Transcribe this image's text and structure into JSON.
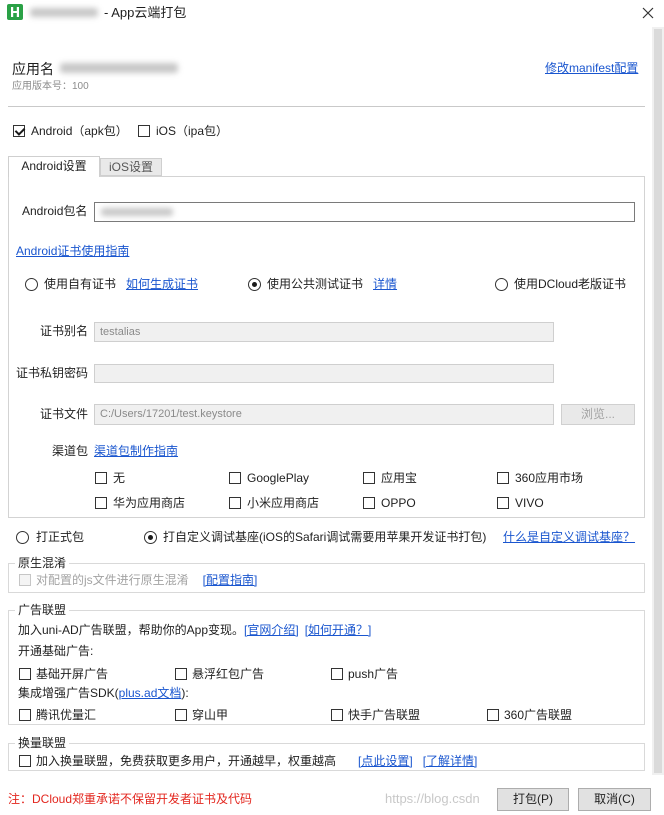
{
  "window": {
    "title": "- App云端打包",
    "logo_letter": "H"
  },
  "icons": {
    "logo": "hbuilder-logo-icon",
    "close": "close-icon"
  },
  "header": {
    "app_name_label": "应用名",
    "version_text": "应用版本号：100",
    "edit_manifest_link": "修改manifest配置"
  },
  "platforms": [
    {
      "label": "Android（apk包）",
      "checked": true
    },
    {
      "label": "iOS（ipa包）",
      "checked": false
    }
  ],
  "tabs": [
    {
      "label": "Android设置",
      "active": true
    },
    {
      "label": "iOS设置",
      "active": false
    }
  ],
  "android": {
    "package_label": "Android包名",
    "cert_guide_link": "Android证书使用指南",
    "cert_options": [
      {
        "label": "使用自有证书",
        "checked": false,
        "link": "如何生成证书"
      },
      {
        "label": "使用公共测试证书",
        "checked": true,
        "link": "详情"
      },
      {
        "label": "使用DCloud老版证书",
        "checked": false
      }
    ],
    "alias_label": "证书别名",
    "alias_value": "testalias",
    "password_label": "证书私钥密码",
    "file_label": "证书文件",
    "file_value": "C:/Users/17201/test.keystore",
    "browse_button": "浏览...",
    "channel_label": "渠道包",
    "channel_guide_link": "渠道包制作指南",
    "channels": [
      {
        "label": "无",
        "checked": false
      },
      {
        "label": "GooglePlay",
        "checked": false
      },
      {
        "label": "应用宝",
        "checked": false
      },
      {
        "label": "360应用市场",
        "checked": false
      },
      {
        "label": "华为应用商店",
        "checked": false
      },
      {
        "label": "小米应用商店",
        "checked": false
      },
      {
        "label": "OPPO",
        "checked": false
      },
      {
        "label": "VIVO",
        "checked": false
      }
    ]
  },
  "build_type": {
    "options": [
      {
        "label": "打正式包",
        "checked": false
      },
      {
        "label": "打自定义调试基座(iOS的Safari调试需要用苹果开发证书打包)",
        "checked": true
      }
    ],
    "help_link": "什么是自定义调试基座？"
  },
  "obfuscation": {
    "legend": "原生混淆",
    "checkbox_label": "对配置的js文件进行原生混淆",
    "checked": false,
    "disabled": true,
    "guide_link": "[配置指南]"
  },
  "ads": {
    "legend": "广告联盟",
    "intro_text": "加入uni-AD广告联盟，帮助你的App变现。",
    "intro_links": [
      "[官网介绍]",
      "[如何开通？]"
    ],
    "basic_heading": "开通基础广告:",
    "basic": [
      {
        "label": "基础开屏广告",
        "checked": false
      },
      {
        "label": "悬浮红包广告",
        "checked": false
      },
      {
        "label": "push广告",
        "checked": false
      }
    ],
    "sdk_heading_prefix": "集成增强广告SDK(",
    "sdk_heading_link": "plus.ad文档",
    "sdk_heading_suffix": "):",
    "sdk": [
      {
        "label": "腾讯优量汇",
        "checked": false
      },
      {
        "label": "穿山甲",
        "checked": false
      },
      {
        "label": "快手广告联盟",
        "checked": false
      },
      {
        "label": "360广告联盟",
        "checked": false
      }
    ]
  },
  "exchange": {
    "legend": "换量联盟",
    "checkbox_label": "加入换量联盟，免费获取更多用户，开通越早，权重越高",
    "checked": false,
    "links": [
      "[点此设置]",
      "[了解详情]"
    ]
  },
  "footer": {
    "note": "注：DCloud郑重承诺不保留开发者证书及代码",
    "watermark": "https://blog.csdn",
    "build_button": "打包(P)",
    "cancel_button": "取消(C)"
  },
  "colors": {
    "link": "#1a56cf",
    "note_red": "#e3261e",
    "logo_green": "#2aa146"
  }
}
